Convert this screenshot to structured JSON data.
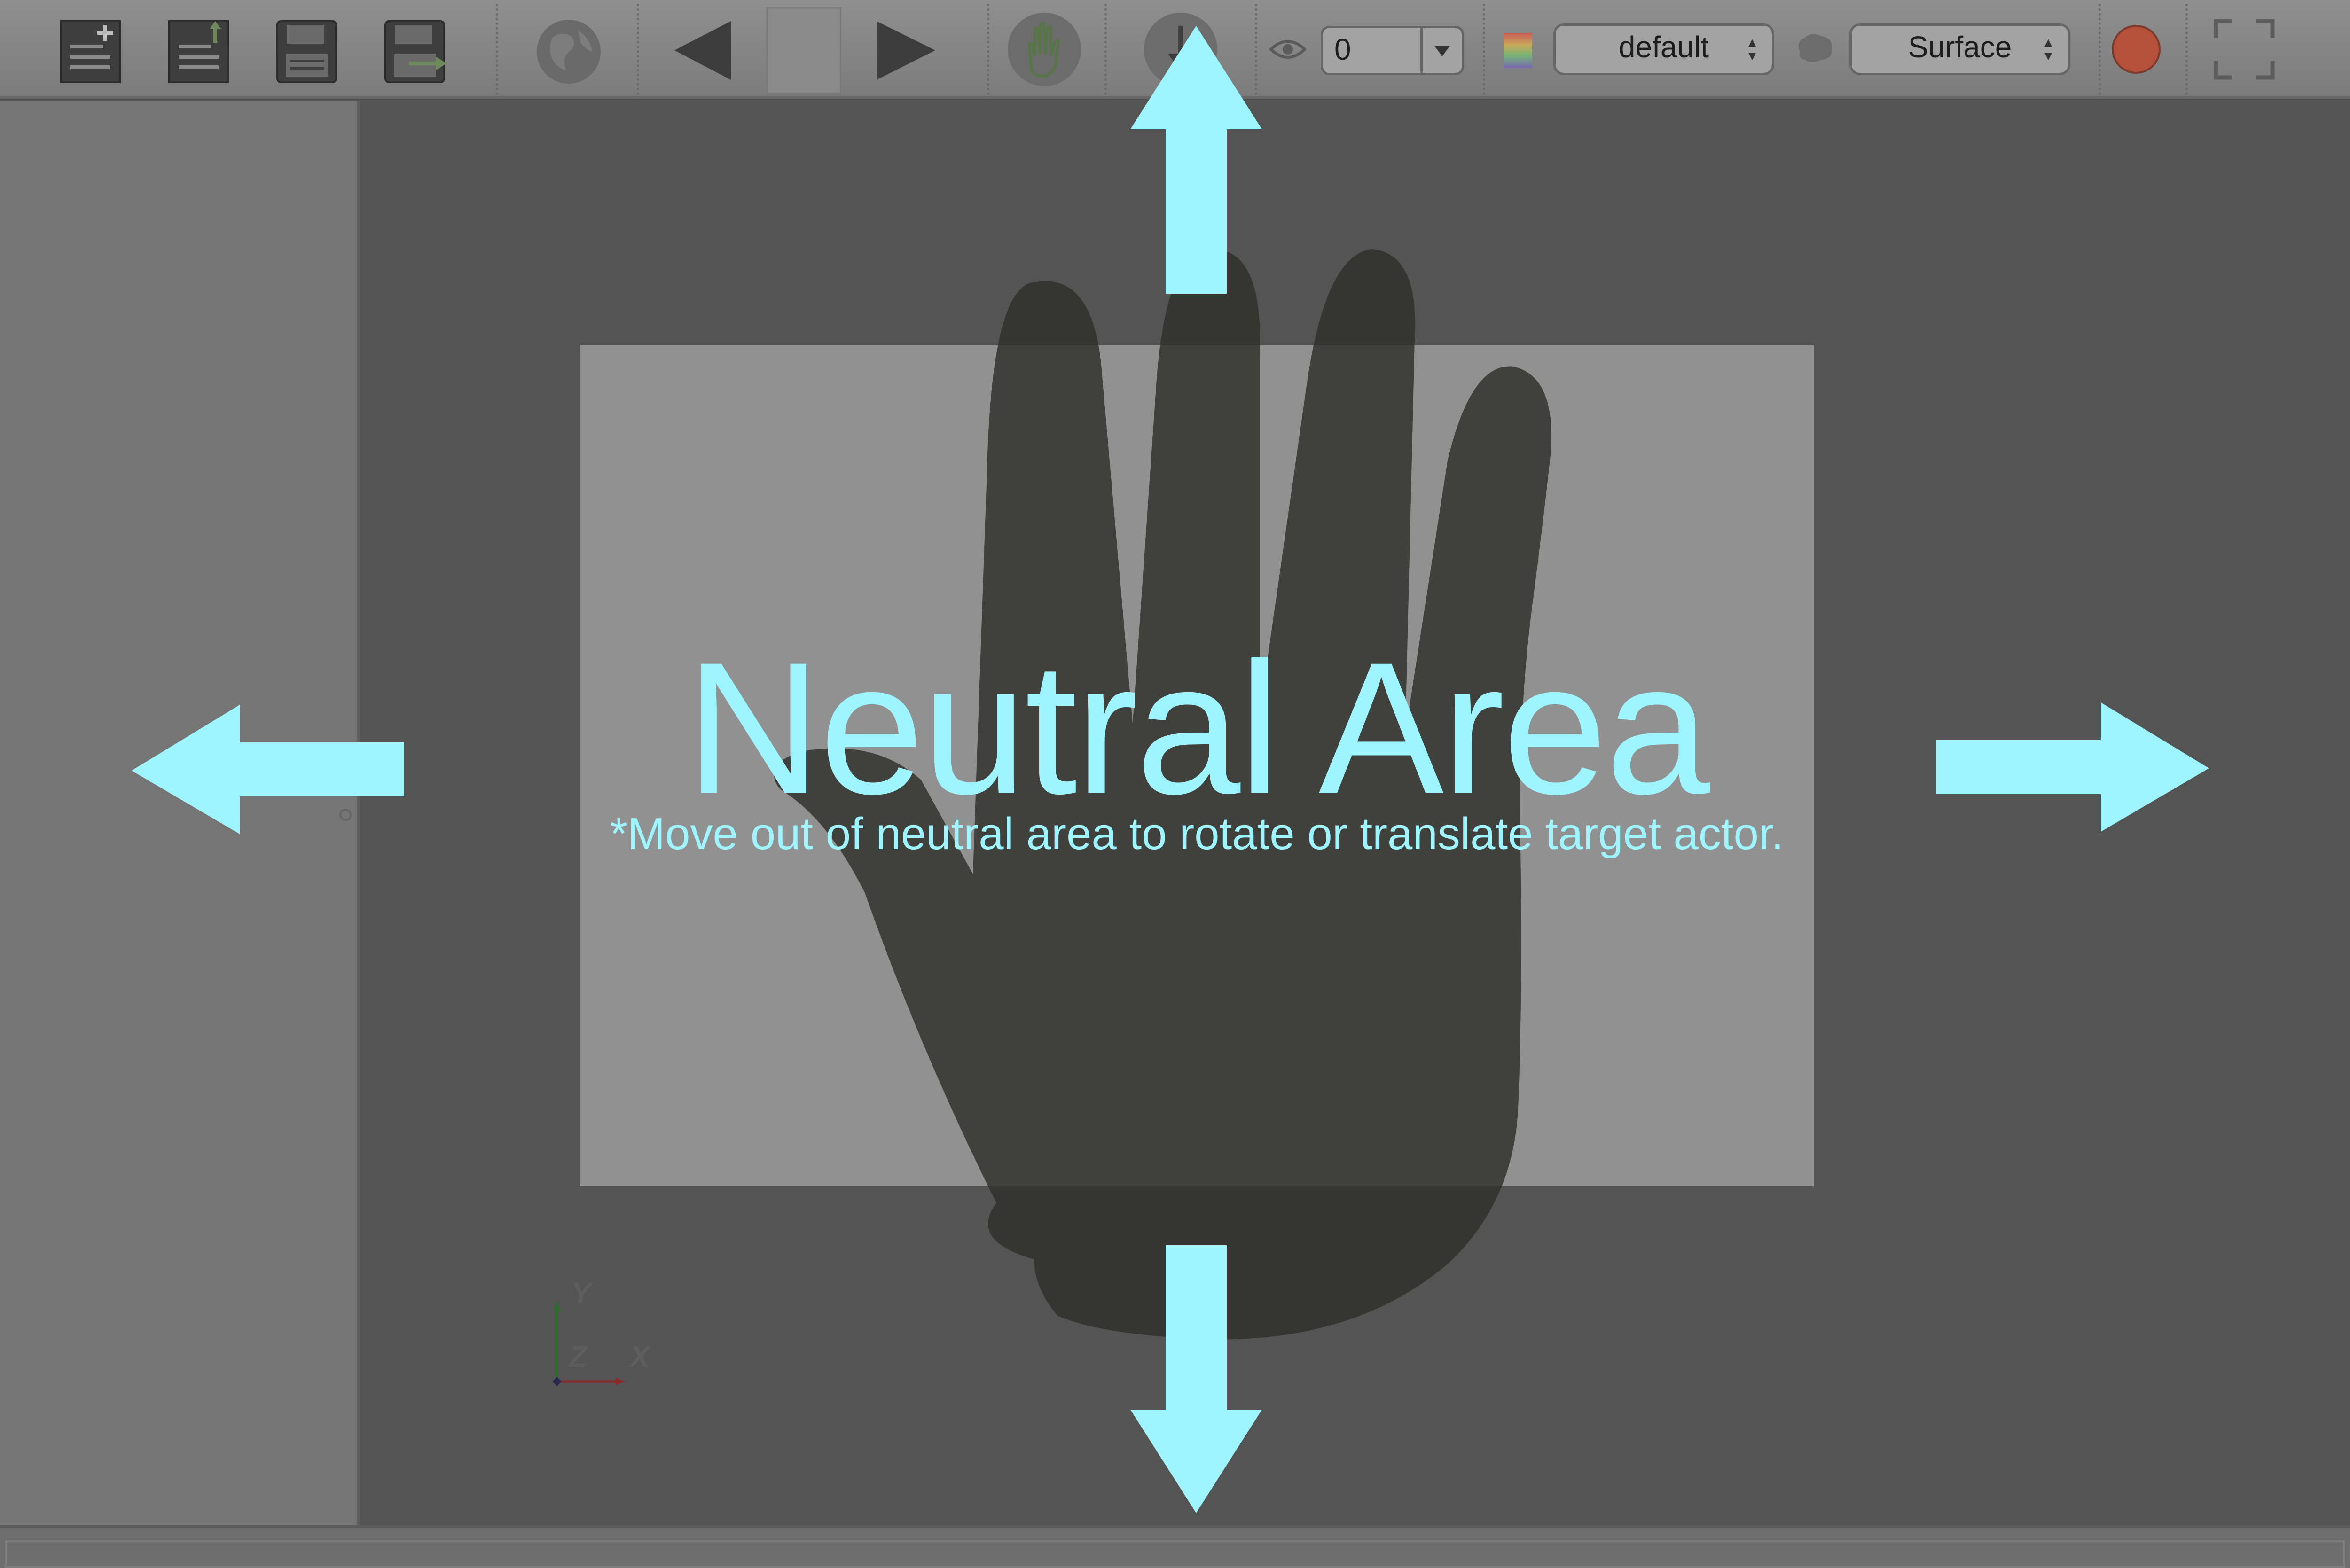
{
  "toolbar": {
    "buttons": [
      {
        "name": "new-document-icon"
      },
      {
        "name": "open-document-icon"
      },
      {
        "name": "save-icon"
      },
      {
        "name": "save-as-icon"
      },
      {
        "name": "globe-icon"
      },
      {
        "name": "previous-icon"
      },
      {
        "name": "blank-button"
      },
      {
        "name": "next-icon"
      },
      {
        "name": "hand-icon"
      },
      {
        "name": "download-icon"
      },
      {
        "name": "eye-icon"
      },
      {
        "name": "colormap-icon"
      },
      {
        "name": "brain-icon"
      },
      {
        "name": "record-icon"
      },
      {
        "name": "fullscreen-icon"
      }
    ],
    "frame_value": "0",
    "colormap_select": "default",
    "representation_select": "Surface",
    "colors": {
      "record": "#b5503a",
      "hand": "#58754a"
    }
  },
  "overlay": {
    "title": "Neutral Area",
    "subtitle": "*Move out of neutral area to rotate or translate target actor.",
    "arrow_color": "#9ef5ff",
    "arrows": [
      "up-arrow-icon",
      "down-arrow-icon",
      "left-arrow-icon",
      "right-arrow-icon"
    ],
    "hand_icon": "hand-silhouette-icon"
  },
  "axes": {
    "y": "Y",
    "z": "Z",
    "x": "X"
  }
}
